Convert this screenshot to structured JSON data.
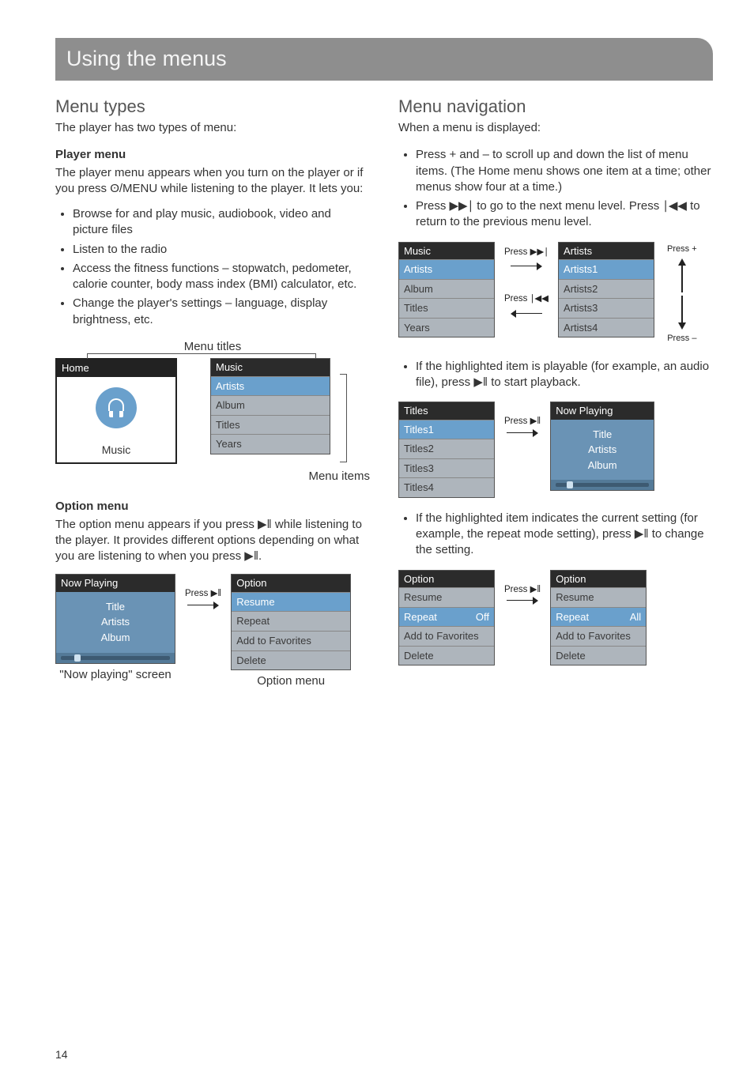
{
  "page_number": "14",
  "banner": "Using the menus",
  "left": {
    "h_types": "Menu types",
    "types_sub": "The player has two types of menu:",
    "player_menu_h": "Player menu",
    "player_menu_p": "The player menu appears when you turn on the player or if you press ʘ/MENU while listening to the player. It lets you:",
    "player_bullets": [
      "Browse for and play music, audiobook, video and picture files",
      "Listen to the radio",
      "Access the fitness functions – stopwatch, pedometer, calorie counter, body mass index (BMI) calculator, etc.",
      "Change the player's settings – language, display brightness, etc."
    ],
    "menu_titles_label": "Menu titles",
    "home": {
      "title": "Home",
      "footer": "Music"
    },
    "music_menu": {
      "title": "Music",
      "items": [
        "Artists",
        "Album",
        "Titles",
        "Years"
      ],
      "selected": 0
    },
    "menu_items_label": "Menu items",
    "option_menu_h": "Option menu",
    "option_menu_p": "The option menu appears if you press ▶‖ while listening to the player. It provides different options depending on what you are listening to when you press ▶‖.",
    "now_playing": {
      "title": "Now Playing",
      "l1": "Title",
      "l2": "Artists",
      "l3": "Album"
    },
    "press_play": "Press ▶‖",
    "option_panel": {
      "title": "Option",
      "items": [
        "Resume",
        "Repeat",
        "Add to Favorites",
        "Delete"
      ],
      "selected": 0
    },
    "np_caption": "\"Now playing\" screen",
    "opt_caption": "Option menu"
  },
  "right": {
    "h_nav": "Menu navigation",
    "nav_sub": "When a menu is displayed:",
    "nav_bullets": [
      "Press + and – to scroll up and down the list of menu items. (The Home menu shows one item at a time; other menus show four at a time.)",
      "Press ▶▶∣ to go to the next menu level. Press ∣◀◀ to return to the previous menu level."
    ],
    "fig1": {
      "left": {
        "title": "Music",
        "items": [
          "Artists",
          "Album",
          "Titles",
          "Years"
        ],
        "selected": 0
      },
      "press_next": "Press ▶▶∣",
      "press_prev": "Press ∣◀◀",
      "right": {
        "title": "Artists",
        "items": [
          "Artists1",
          "Artists2",
          "Artists3",
          "Artists4"
        ],
        "selected": 0
      },
      "press_plus": "Press +",
      "press_minus": "Press –"
    },
    "play_bullet": "If the highlighted item is playable (for example, an audio file), press ▶‖ to start playback.",
    "fig2": {
      "left": {
        "title": "Titles",
        "items": [
          "Titles1",
          "Titles2",
          "Titles3",
          "Titles4"
        ],
        "selected": 0
      },
      "press_play": "Press ▶‖",
      "np": {
        "title": "Now Playing",
        "l1": "Title",
        "l2": "Artists",
        "l3": "Album"
      }
    },
    "setting_bullet": "If the highlighted item indicates the current setting (for example, the repeat mode setting), press ▶‖ to change the setting.",
    "fig3": {
      "left": {
        "title": "Option",
        "items": [
          [
            "Resume",
            ""
          ],
          [
            "Repeat",
            "Off"
          ],
          [
            "Add to Favorites",
            ""
          ],
          [
            "Delete",
            ""
          ]
        ],
        "selected": 1
      },
      "press_play": "Press ▶‖",
      "right": {
        "title": "Option",
        "items": [
          [
            "Resume",
            ""
          ],
          [
            "Repeat",
            "All"
          ],
          [
            "Add to Favorites",
            ""
          ],
          [
            "Delete",
            ""
          ]
        ],
        "selected": 1
      }
    }
  }
}
